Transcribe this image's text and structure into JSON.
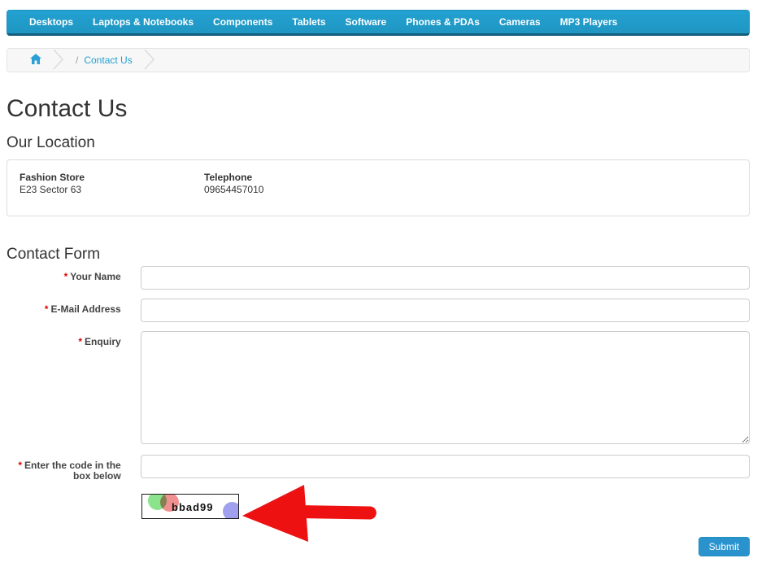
{
  "nav": {
    "items": [
      "Desktops",
      "Laptops & Notebooks",
      "Components",
      "Tablets",
      "Software",
      "Phones & PDAs",
      "Cameras",
      "MP3 Players"
    ]
  },
  "breadcrumb": {
    "separator_slash": "/",
    "current": "Contact Us"
  },
  "page": {
    "title": "Contact Us"
  },
  "location": {
    "heading": "Our Location",
    "store_name": "Fashion Store",
    "address": "E23 Sector 63",
    "telephone_label": "Telephone",
    "telephone_number": "09654457010"
  },
  "contact_form": {
    "heading": "Contact Form",
    "required_marker": "*",
    "name_label": "Your Name",
    "name_value": "",
    "email_label": "E-Mail Address",
    "email_value": "",
    "enquiry_label": "Enquiry",
    "enquiry_value": "",
    "captcha_label": "Enter the code in the box below",
    "captcha_value": "",
    "captcha_code": "bbad99",
    "submit_label": "Submit"
  },
  "icons": {
    "breadcrumb_home": "home-icon",
    "annotation": "red-arrow-pointer"
  },
  "colors": {
    "nav_bg": "#23a1d1",
    "nav_border_bottom": "#145e7a",
    "link": "#23a1d1",
    "button_bg": "#2a93ce",
    "required": "#e00505",
    "arrow": "#ee1111",
    "captcha_green": "#8be48b",
    "captcha_red": "#f09090",
    "captcha_purple": "#a0a0ee"
  }
}
